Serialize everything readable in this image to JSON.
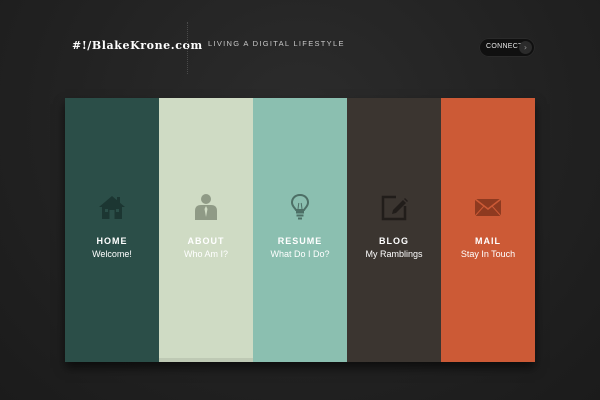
{
  "header": {
    "logo": "#!/BlakeKrone.com",
    "tagline": "LIVING A DIGITAL LIFESTYLE",
    "connect_label": "CONNECT",
    "connect_arrow": "›"
  },
  "panels": [
    {
      "title": "HOME",
      "subtitle": "Welcome!",
      "icon": "house-icon",
      "color": "#2b4e48"
    },
    {
      "title": "ABOUT",
      "subtitle": "Who Am I?",
      "icon": "person-icon",
      "color": "#cfdbc4"
    },
    {
      "title": "RESUME",
      "subtitle": "What Do I Do?",
      "icon": "lightbulb-icon",
      "color": "#8bbfb0"
    },
    {
      "title": "BLOG",
      "subtitle": "My Ramblings",
      "icon": "edit-icon",
      "color": "#3b3530"
    },
    {
      "title": "MAIL",
      "subtitle": "Stay In Touch",
      "icon": "envelope-icon",
      "color": "#cc5a36"
    }
  ]
}
